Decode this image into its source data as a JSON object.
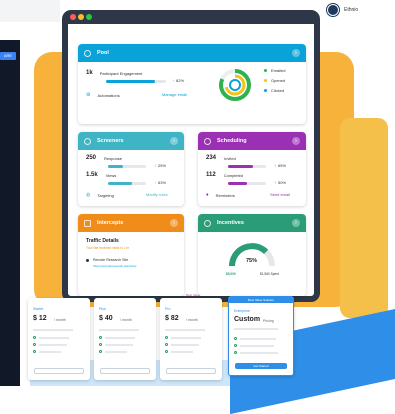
{
  "sidebar": {
    "tag_label": "ARE"
  },
  "header": {
    "user_name": "Ethnio"
  },
  "pool": {
    "title": "Pool",
    "participant_count": "1k",
    "participant_label": "Participant Engagement",
    "participant_change": "82%",
    "automations_label": "Automations",
    "automations_link": "Manage email",
    "legend": [
      "Emailed",
      "Opened",
      "Clicked"
    ],
    "engagement_pct": 82
  },
  "screeners": {
    "title": "Screeners",
    "response_count": "250",
    "response_label": "Response",
    "response_change": "25%",
    "views_count": "1.5k",
    "views_label": "Views",
    "views_change": "63%",
    "targeting_label": "Targeting",
    "targeting_link": "Modify rules",
    "response_pct": 25,
    "views_pct": 63
  },
  "scheduling": {
    "title": "Scheduling",
    "invited_count": "234",
    "invited_label": "Invited",
    "invited_change": "65%",
    "completed_count": "112",
    "completed_label": "Completed",
    "completed_change": "50%",
    "reminders_label": "Reminders",
    "reminders_link": "Send email",
    "invited_pct": 65,
    "completed_pct": 50
  },
  "intercepts": {
    "title": "Intercepts",
    "traffic_title": "Traffic Details",
    "traffic_sub": "Your site received visits in 1 hr",
    "site_label": "Remote Research Site",
    "site_url": "https://remoteresearch.site/study"
  },
  "incentives": {
    "title": "Incentives",
    "gauge_value": "75%",
    "left_label": "$5,000",
    "right_label": "$1,560 Spent",
    "gauge_pct": 75
  },
  "pricing": {
    "callout": "Best Value",
    "featured_badge": "Best Value Solution",
    "plans": [
      {
        "name": "Starter",
        "price": "$ 12",
        "period": "/ month"
      },
      {
        "name": "Plus",
        "price": "$ 40",
        "period": "/ month"
      },
      {
        "name": "Pro",
        "price": "$ 82",
        "period": "/ month"
      },
      {
        "name": "Enterprise",
        "price": "Custom",
        "period": "Pricing"
      }
    ],
    "enterprise_button": "Get Started"
  },
  "colors": {
    "pool": "#0aa3d9",
    "screeners": "#3fb4c4",
    "scheduling": "#9b30b5",
    "intercepts": "#f08c1a",
    "incentives": "#2a9d78"
  }
}
